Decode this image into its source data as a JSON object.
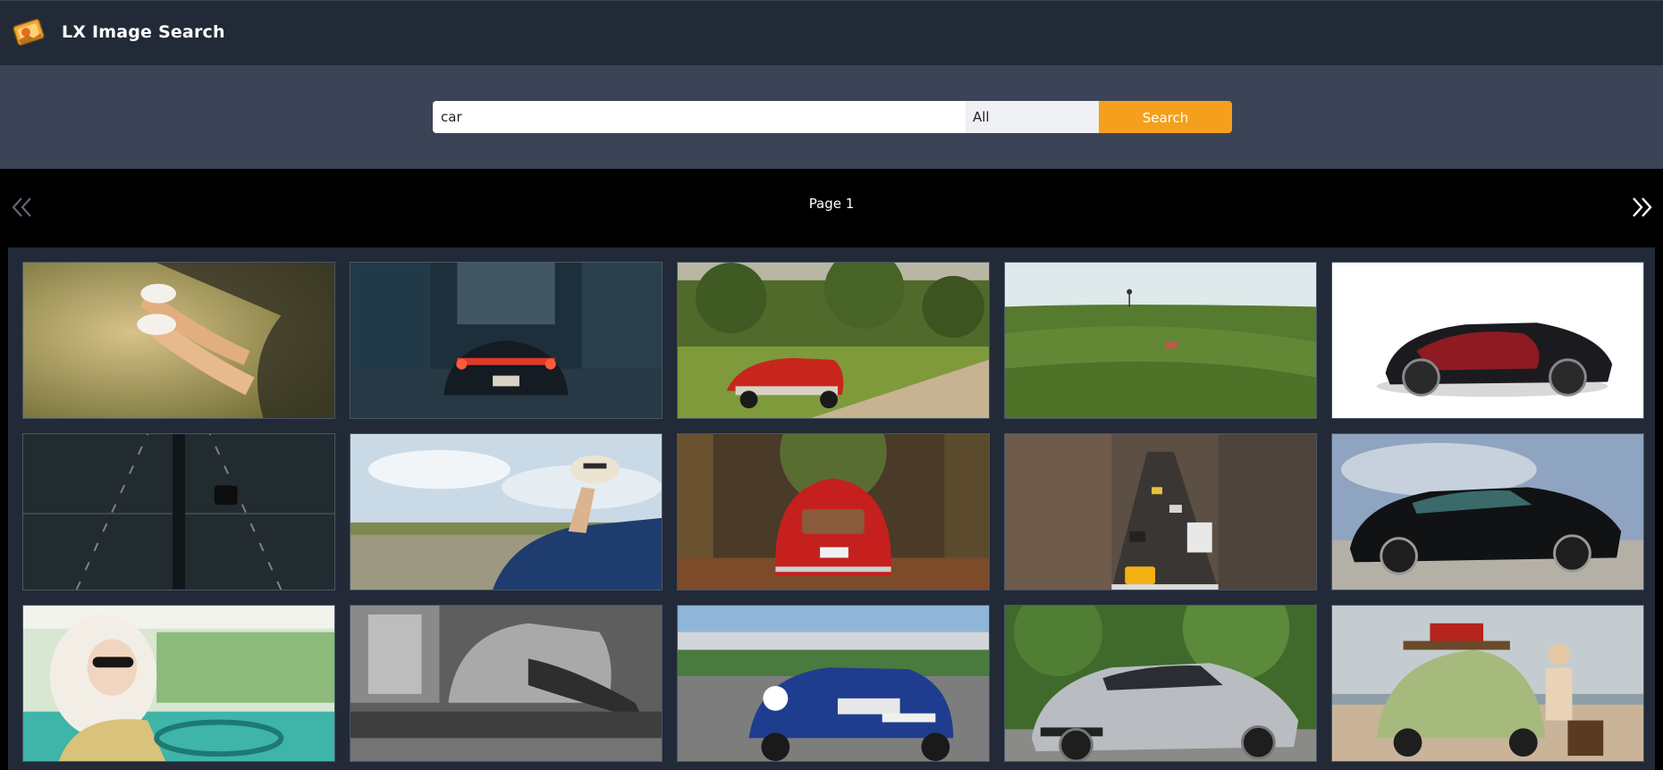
{
  "app": {
    "title": "LX Image Search"
  },
  "search": {
    "query": "car",
    "placeholder": "",
    "category": "All",
    "button_label": "Search"
  },
  "pager": {
    "label": "Page 1"
  },
  "colors": {
    "header": "#222a38",
    "search_band": "#3a4456",
    "accent": "#f4a01e",
    "gallery": "#222a38"
  },
  "gallery": {
    "tiles": [
      {
        "icon": "image-sneakers-car-window"
      },
      {
        "icon": "image-car-rear-city-night"
      },
      {
        "icon": "image-red-vintage-convertible"
      },
      {
        "icon": "image-car-on-green-hills"
      },
      {
        "icon": "image-red-black-supercar"
      },
      {
        "icon": "image-aerial-road-car"
      },
      {
        "icon": "image-hat-out-car-window"
      },
      {
        "icon": "image-red-fiat-forest"
      },
      {
        "icon": "image-city-traffic-taxi"
      },
      {
        "icon": "image-black-mustang"
      },
      {
        "icon": "image-woman-vintage-car"
      },
      {
        "icon": "image-monochrome-garage"
      },
      {
        "icon": "image-blue-race-car"
      },
      {
        "icon": "image-silver-mercedes-amg"
      },
      {
        "icon": "image-green-beetle-beach"
      }
    ]
  }
}
